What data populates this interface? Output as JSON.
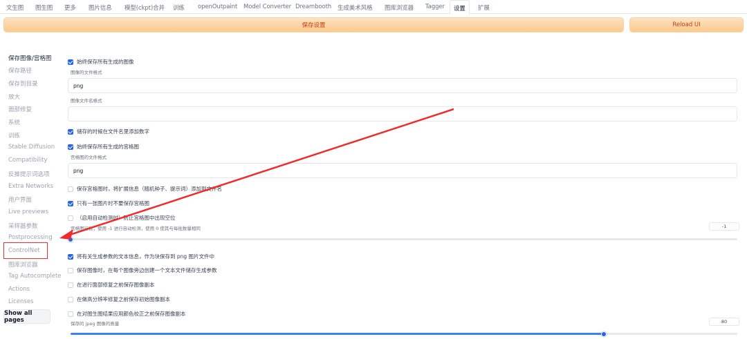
{
  "tabs": [
    "文生图",
    "图生图",
    "更多",
    "图片信息",
    "模型(ckpt)合并",
    "训练",
    "openOutpaint",
    "Model Converter",
    "Dreambooth",
    "生成美术风格",
    "图库浏览器",
    "Tagger",
    "设置",
    "扩展"
  ],
  "active_tab": "设置",
  "buttons": {
    "save": "保存设置",
    "reload": "Reload UI"
  },
  "sidebar": {
    "items": [
      "保存图像/宫格图",
      "保存路径",
      "保存到目录",
      "放大",
      "面部修复",
      "系统",
      "训练",
      "Stable Diffusion",
      "Compatibility",
      "反推提示词选项",
      "Extra Networks",
      "用户界面",
      "Live previews",
      "采样器参数",
      "Postprocessing",
      "ControlNet",
      "图库浏览器",
      "Tag Autocomplete",
      "Actions",
      "Licenses"
    ],
    "active": "保存图像/宫格图",
    "show_all": "Show all pages"
  },
  "settings": {
    "always_save_images": "始终保存所有生成的图像",
    "image_format_label": "图像的文件格式",
    "image_format_value": "png",
    "filename_pattern_label": "图像文件名格式",
    "filename_pattern_value": "",
    "add_number": "储存的时候在文件名里添加数字",
    "always_save_grids": "始终保存所有生成的宫格图",
    "grid_format_label": "宫格图的文件格式",
    "grid_format_value": "png",
    "grid_extended_filename": "保存宫格图时，将扩展信息（随机种子、提示词）添加到文件名",
    "grid_only_if_multiple": "只有一张图片时不要保存宫格图",
    "grid_prevent_empty": "（启用自动检测时）防止宫格图中出现空位",
    "grid_rows_label": "宫格图行数；使用 -1 进行自动检测，使用 0 使其与每批数量相同",
    "grid_rows_value": "-1",
    "grid_rows_slider_fraction": 0.0,
    "save_text_info": "将有关生成参数的文本信息，作为块保存到 png 图片文件中",
    "save_txt": "保存图像时，在每个图像旁边创建一个文本文件储存生成参数",
    "save_before_face_restore": "在进行面部修复之前保存图像副本",
    "save_before_highres": "在做高分辨率修复之前保存初始图像副本",
    "save_before_color_correction": "在对图生图结果应用颜色校正之前保存图像副本",
    "jpeg_quality_label": "保存的 jpeg 图像的质量",
    "jpeg_quality_value": "80",
    "jpeg_quality_slider_fraction": 0.8
  },
  "colors": {
    "accent": "#2563eb",
    "annotation": "#ef2b2b",
    "button": "#fbc98b"
  }
}
